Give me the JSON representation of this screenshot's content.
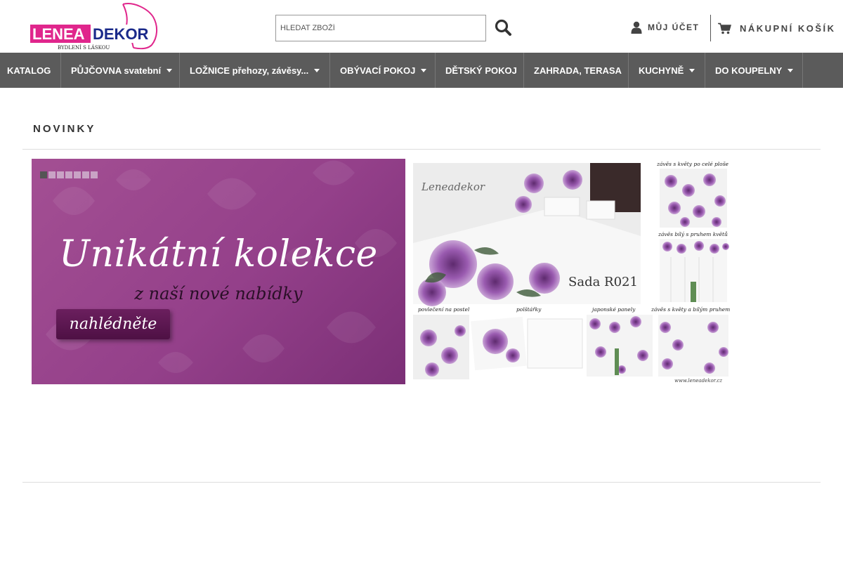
{
  "header": {
    "logo": {
      "brand": "LENEADEKOR",
      "tagline": "BYDLENÍ S LÁSKOU"
    },
    "search": {
      "placeholder": "HLEDAT ZBOŽÍ",
      "value": ""
    },
    "account_label": "MŮJ ÚČET",
    "cart_label": "NÁKUPNÍ KOŠÍK"
  },
  "nav": {
    "items": [
      {
        "label": "KATALOG",
        "has_dropdown": false
      },
      {
        "label": "PŮJČOVNA svatební",
        "has_dropdown": true
      },
      {
        "label": "LOŽNICE přehozy, závěsy...",
        "has_dropdown": true
      },
      {
        "label": "OBÝVACÍ POKOJ",
        "has_dropdown": true
      },
      {
        "label": "DĚTSKÝ POKOJ",
        "has_dropdown": false
      },
      {
        "label": "ZAHRADA, TERASA",
        "has_dropdown": false
      },
      {
        "label": "KUCHYNĚ",
        "has_dropdown": true
      },
      {
        "label": "DO KOUPELNY",
        "has_dropdown": true
      }
    ]
  },
  "main": {
    "section_title": "NOVINKY",
    "slider": {
      "dot_count": 7,
      "active_index": 0,
      "title": "Unikátní kolekce",
      "subtitle": "z naší nové nabídky",
      "button_label": "nahlédněte"
    },
    "collage": {
      "brand": "Leneadekor",
      "set_name": "Sada R021",
      "captions": {
        "curtain_full": "závěs s květy po celé ploše",
        "curtain_stripe": "závěs bílý s pruhem květů",
        "bedding": "povlečení na postel",
        "pillows": "polštářky",
        "panels": "japonské panely",
        "curtain_white": "závěs s květy a bílým pruhem"
      },
      "website": "www.leneadekor.cz"
    }
  },
  "colors": {
    "nav_bg": "#5b5b5b",
    "accent_pink": "#e0268c",
    "banner_purple": "#9a4690",
    "flower_purple": "#8e4a9e"
  }
}
